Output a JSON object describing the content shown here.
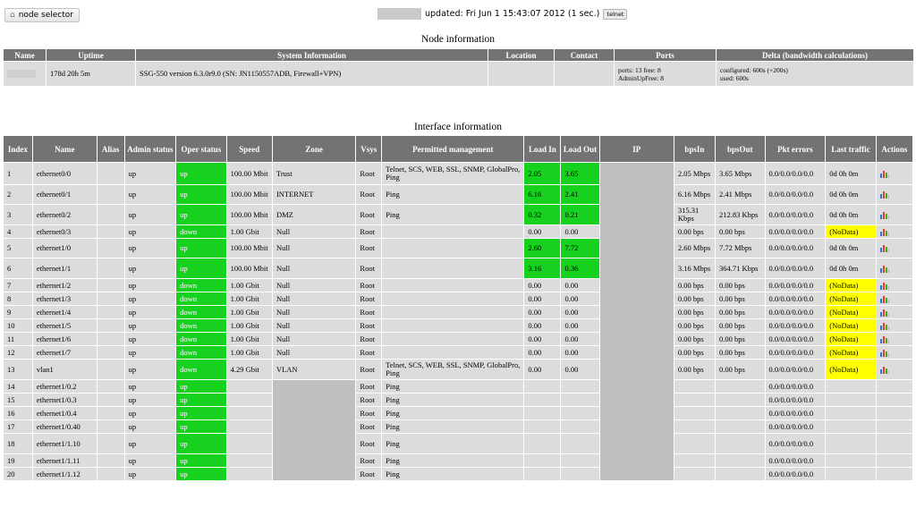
{
  "top": {
    "node_selector_label": "node selector",
    "updated_text": "updated: Fri Jun 1 15:43:07 2012 (1 sec.)",
    "telnet_label": "telnet"
  },
  "node_info": {
    "title": "Node information",
    "headers": [
      "Name",
      "Uptime",
      "System Information",
      "Location",
      "Contact",
      "Ports",
      "Delta (bandwidth calculations)"
    ],
    "row": {
      "uptime": "178d 20h 5m",
      "system": "SSG-550 version 6.3.0r9.0 (SN: JN1150557ADB, Firewall+VPN)",
      "location": "",
      "contact": "",
      "ports_line1": "ports: 13 free: 8",
      "ports_line2": "AdminUpFree: 8",
      "delta_line1": "configured: 600s (+200s)",
      "delta_line2": "used: 600s"
    }
  },
  "iface": {
    "title": "Interface information",
    "headers": [
      "Index",
      "Name",
      "Alias",
      "Admin status",
      "Oper status",
      "Speed",
      "Zone",
      "Vsys",
      "Permitted management",
      "Load In",
      "Load Out",
      "IP",
      "bpsIn",
      "bpsOut",
      "Pkt errors",
      "Last traffic",
      "Actions"
    ],
    "rows": [
      {
        "idx": "1",
        "name": "ethernet0/0",
        "admin": "up",
        "oper": "up",
        "speed": "100.00 Mbit",
        "zone": "Trust",
        "vsys": "Root",
        "mgmt": "Telnet, SCS, WEB, SSL, SNMP, GlobalPro, Ping",
        "lin": "2.05",
        "lout": "3.65",
        "bin": "2.05 Mbps",
        "bout": "3.65 Mbps",
        "pkt": "0.0/0.0/0.0/0.0",
        "last": "0d 0h 0m"
      },
      {
        "idx": "2",
        "name": "ethernet0/1",
        "admin": "up",
        "oper": "up",
        "speed": "100.00 Mbit",
        "zone": "INTERNET",
        "vsys": "Root",
        "mgmt": "Ping",
        "lin": "6.16",
        "lout": "2.41",
        "bin": "6.16 Mbps",
        "bout": "2.41 Mbps",
        "pkt": "0.0/0.0/0.0/0.0",
        "last": "0d 0h 0m"
      },
      {
        "idx": "3",
        "name": "ethernet0/2",
        "admin": "up",
        "oper": "up",
        "speed": "100.00 Mbit",
        "zone": "DMZ",
        "vsys": "Root",
        "mgmt": "Ping",
        "lin": "0.32",
        "lout": "0.21",
        "bin": "315.31 Kbps",
        "bout": "212.83 Kbps",
        "pkt": "0.0/0.0/0.0/0.0",
        "last": "0d 0h 0m"
      },
      {
        "idx": "4",
        "name": "ethernet0/3",
        "admin": "up",
        "oper": "down",
        "speed": "1.00 Gbit",
        "zone": "Null",
        "vsys": "Root",
        "mgmt": "",
        "lin": "0.00",
        "lout": "0.00",
        "bin": "0.00 bps",
        "bout": "0.00 bps",
        "pkt": "0.0/0.0/0.0/0.0",
        "last": "(NoData)"
      },
      {
        "idx": "5",
        "name": "ethernet1/0",
        "admin": "up",
        "oper": "up",
        "speed": "100.00 Mbit",
        "zone": "Null",
        "vsys": "Root",
        "mgmt": "",
        "lin": "2.60",
        "lout": "7.72",
        "bin": "2.60 Mbps",
        "bout": "7.72 Mbps",
        "pkt": "0.0/0.0/0.0/0.0",
        "last": "0d 0h 0m"
      },
      {
        "idx": "6",
        "name": "ethernet1/1",
        "admin": "up",
        "oper": "up",
        "speed": "100.00 Mbit",
        "zone": "Null",
        "vsys": "Root",
        "mgmt": "",
        "lin": "3.16",
        "lout": "0.36",
        "bin": "3.16 Mbps",
        "bout": "364.71 Kbps",
        "pkt": "0.0/0.0/0.0/0.0",
        "last": "0d 0h 0m"
      },
      {
        "idx": "7",
        "name": "ethernet1/2",
        "admin": "up",
        "oper": "down",
        "speed": "1.00 Gbit",
        "zone": "Null",
        "vsys": "Root",
        "mgmt": "",
        "lin": "0.00",
        "lout": "0.00",
        "bin": "0.00 bps",
        "bout": "0.00 bps",
        "pkt": "0.0/0.0/0.0/0.0",
        "last": "(NoData)"
      },
      {
        "idx": "8",
        "name": "ethernet1/3",
        "admin": "up",
        "oper": "down",
        "speed": "1.00 Gbit",
        "zone": "Null",
        "vsys": "Root",
        "mgmt": "",
        "lin": "0.00",
        "lout": "0.00",
        "bin": "0.00 bps",
        "bout": "0.00 bps",
        "pkt": "0.0/0.0/0.0/0.0",
        "last": "(NoData)"
      },
      {
        "idx": "9",
        "name": "ethernet1/4",
        "admin": "up",
        "oper": "down",
        "speed": "1.00 Gbit",
        "zone": "Null",
        "vsys": "Root",
        "mgmt": "",
        "lin": "0.00",
        "lout": "0.00",
        "bin": "0.00 bps",
        "bout": "0.00 bps",
        "pkt": "0.0/0.0/0.0/0.0",
        "last": "(NoData)"
      },
      {
        "idx": "10",
        "name": "ethernet1/5",
        "admin": "up",
        "oper": "down",
        "speed": "1.00 Gbit",
        "zone": "Null",
        "vsys": "Root",
        "mgmt": "",
        "lin": "0.00",
        "lout": "0.00",
        "bin": "0.00 bps",
        "bout": "0.00 bps",
        "pkt": "0.0/0.0/0.0/0.0",
        "last": "(NoData)"
      },
      {
        "idx": "11",
        "name": "ethernet1/6",
        "admin": "up",
        "oper": "down",
        "speed": "1.00 Gbit",
        "zone": "Null",
        "vsys": "Root",
        "mgmt": "",
        "lin": "0.00",
        "lout": "0.00",
        "bin": "0.00 bps",
        "bout": "0.00 bps",
        "pkt": "0.0/0.0/0.0/0.0",
        "last": "(NoData)"
      },
      {
        "idx": "12",
        "name": "ethernet1/7",
        "admin": "up",
        "oper": "down",
        "speed": "1.00 Gbit",
        "zone": "Null",
        "vsys": "Root",
        "mgmt": "",
        "lin": "0.00",
        "lout": "0.00",
        "bin": "0.00 bps",
        "bout": "0.00 bps",
        "pkt": "0.0/0.0/0.0/0.0",
        "last": "(NoData)"
      },
      {
        "idx": "13",
        "name": "vlan1",
        "admin": "up",
        "oper": "down",
        "speed": "4.29 Gbit",
        "zone": "VLAN",
        "vsys": "Root",
        "mgmt": "Telnet, SCS, WEB, SSL, SNMP, GlobalPro, Ping",
        "lin": "0.00",
        "lout": "0.00",
        "bin": "0.00 bps",
        "bout": "0.00 bps",
        "pkt": "0.0/0.0/0.0/0.0",
        "last": "(NoData)"
      },
      {
        "idx": "14",
        "name": "ethernet1/0.2",
        "admin": "up",
        "oper": "up",
        "speed": "",
        "zone": "",
        "vsys": "Root",
        "mgmt": "Ping",
        "lin": "",
        "lout": "",
        "bin": "",
        "bout": "",
        "pkt": "0.0/0.0/0.0/0.0",
        "last": ""
      },
      {
        "idx": "15",
        "name": "ethernet1/0.3",
        "admin": "up",
        "oper": "up",
        "speed": "",
        "zone": "",
        "vsys": "Root",
        "mgmt": "Ping",
        "lin": "",
        "lout": "",
        "bin": "",
        "bout": "",
        "pkt": "0.0/0.0/0.0/0.0",
        "last": ""
      },
      {
        "idx": "16",
        "name": "ethernet1/0.4",
        "admin": "up",
        "oper": "up",
        "speed": "",
        "zone": "",
        "vsys": "Root",
        "mgmt": "Ping",
        "lin": "",
        "lout": "",
        "bin": "",
        "bout": "",
        "pkt": "0.0/0.0/0.0/0.0",
        "last": ""
      },
      {
        "idx": "17",
        "name": "ethernet1/0.40",
        "admin": "up",
        "oper": "up",
        "speed": "",
        "zone": "",
        "vsys": "Root",
        "mgmt": "Ping",
        "lin": "",
        "lout": "",
        "bin": "",
        "bout": "",
        "pkt": "0.0/0.0/0.0/0.0",
        "last": ""
      },
      {
        "idx": "18",
        "name": "ethernet1/1.10",
        "admin": "up",
        "oper": "up",
        "speed": "",
        "zone": "",
        "vsys": "Root",
        "mgmt": "Ping",
        "lin": "",
        "lout": "",
        "bin": "",
        "bout": "",
        "pkt": "0.0/0.0/0.0/0.0",
        "last": ""
      },
      {
        "idx": "19",
        "name": "ethernet1/1.11",
        "admin": "up",
        "oper": "up",
        "speed": "",
        "zone": "",
        "vsys": "Root",
        "mgmt": "Ping",
        "lin": "",
        "lout": "",
        "bin": "",
        "bout": "",
        "pkt": "0.0/0.0/0.0/0.0",
        "last": ""
      },
      {
        "idx": "20",
        "name": "ethernet1/1.12",
        "admin": "up",
        "oper": "up",
        "speed": "",
        "zone": "",
        "vsys": "Root",
        "mgmt": "Ping",
        "lin": "",
        "lout": "",
        "bin": "",
        "bout": "",
        "pkt": "0.0/0.0/0.0/0.0",
        "last": ""
      }
    ]
  },
  "colors": {
    "header_bg": "#737373",
    "cell_bg": "#dcdcdc",
    "oper_up": "#16d21e",
    "nodata": "#ffff00",
    "redaction": "#bfbfbf"
  }
}
